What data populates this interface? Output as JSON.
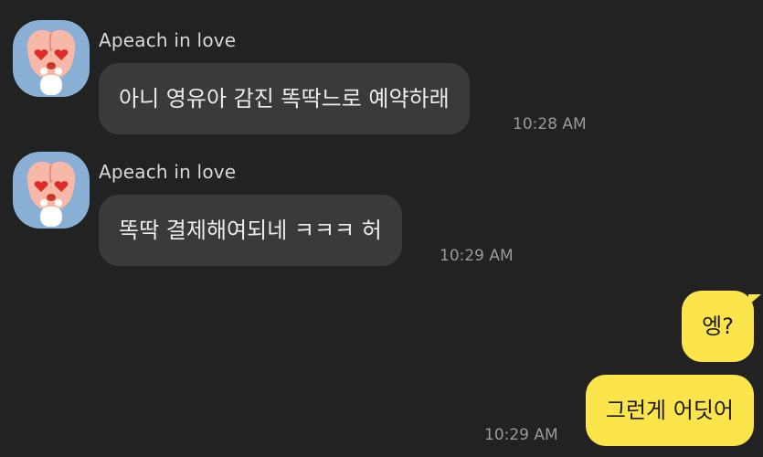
{
  "colors": {
    "background": "#222222",
    "incoming_bubble": "#3a3a3a",
    "outgoing_bubble": "#fce54a",
    "avatar_bg": "#8ab0d6"
  },
  "messages": [
    {
      "direction": "incoming",
      "sender": "Apeach in love",
      "avatar_icon": "apeach-heart-eyes-avatar-icon",
      "text": "아니 영유아 감진 똑딱느로 예약하래",
      "time": "10:28 AM"
    },
    {
      "direction": "incoming",
      "sender": "Apeach in love",
      "avatar_icon": "apeach-heart-eyes-avatar-icon",
      "text": "똑딱 결제해여되네 ㅋㅋㅋ 허",
      "time": "10:29 AM"
    },
    {
      "direction": "outgoing",
      "text": "엥?"
    },
    {
      "direction": "outgoing",
      "text": "그런게 어딧어",
      "time": "10:29 AM"
    }
  ]
}
